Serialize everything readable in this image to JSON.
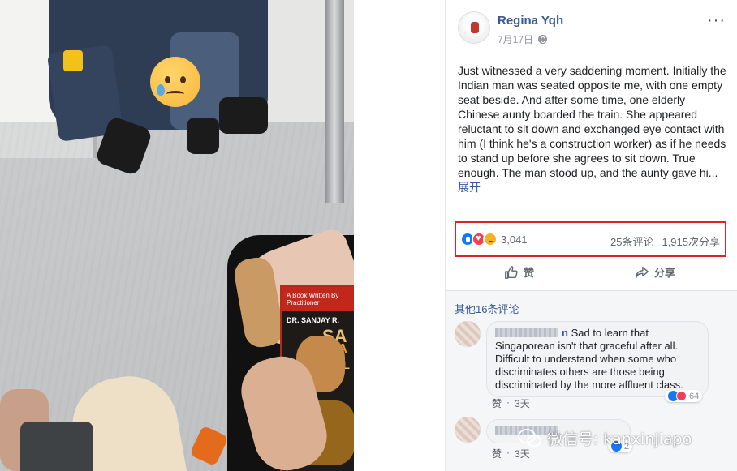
{
  "post": {
    "author": "Regina Yqh",
    "date": "7月17日",
    "more_icon": "ellipsis-icon",
    "body": "Just witnessed a very saddening moment. Initially the Indian man was seated opposite me, with one empty seat beside. And after some time, one elderly Chinese aunty boarded the train. She appeared reluctant to sit down and exchanged eye contact with him (I think he's a construction worker) as if he needs to stand up before she agrees to sit down. True enough. The man stood up, and the aunty gave hi...",
    "expand_label": "展开"
  },
  "stats": {
    "reaction_icons": [
      "like-icon",
      "love-icon",
      "sad-icon"
    ],
    "reaction_count": "3,041",
    "comments": "25条评论",
    "shares": "1,915次分享",
    "highlight_color": "#d9252a"
  },
  "actions": {
    "like_label": "赞",
    "share_label": "分享"
  },
  "comments_section": {
    "more_comments_label": "其他16条评论",
    "comments": [
      {
        "name_tail": "n",
        "text": "Sad to learn that Singaporean isn't that graceful after all. Difficult to understand when some who discriminates others are those being discriminated by the more affluent class.",
        "like_label": "赞",
        "time": "3天",
        "reaction_count": "64"
      },
      {
        "like_label": "赞",
        "time": "3天",
        "reaction_count": "2"
      }
    ]
  },
  "photo": {
    "book_top_text": "A Book Written By Practitioner",
    "book_author": "DR. SANJAY R.",
    "book_title_fragment": "SA",
    "book_title_line2": "MA",
    "book_title_line3": "PL"
  },
  "watermark": {
    "text": "微信号: kanxinjiapo"
  },
  "colors": {
    "link": "#385898",
    "like_blue": "#1877f2",
    "love_red": "#f33e58",
    "sad_yellow": "#f7b125"
  }
}
